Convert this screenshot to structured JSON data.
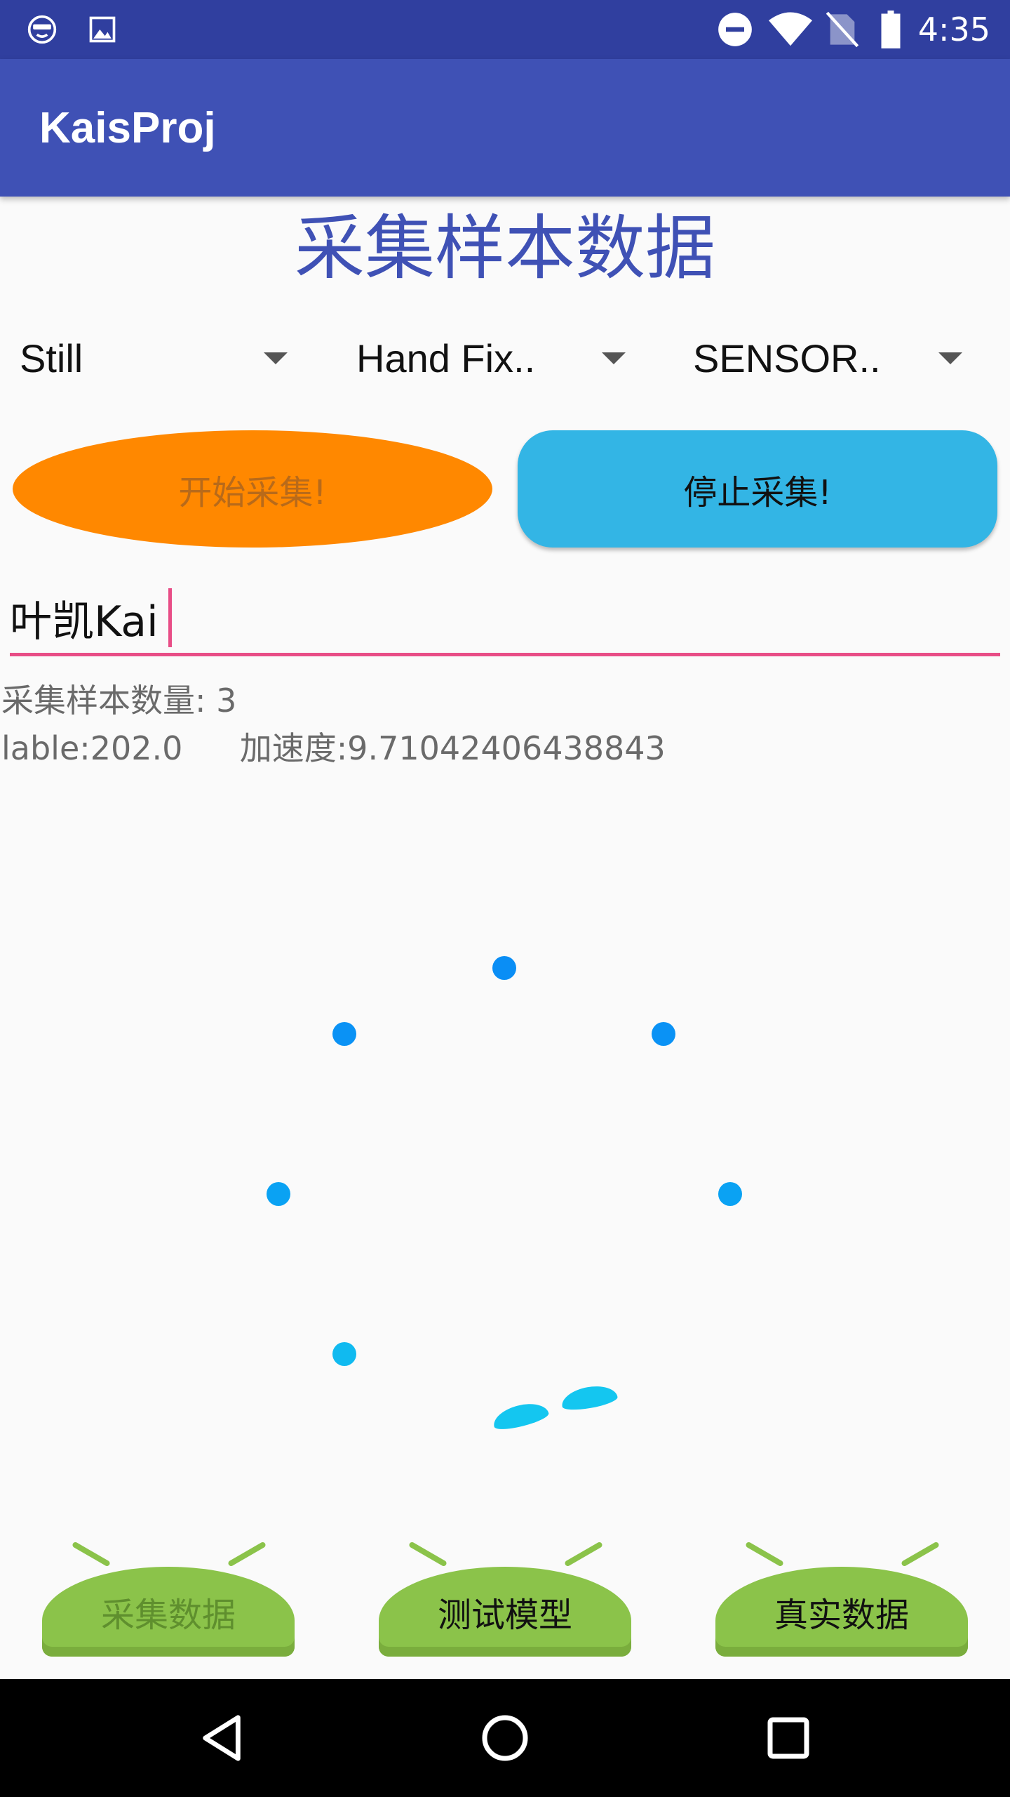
{
  "status_bar": {
    "time": "4:35"
  },
  "app_bar": {
    "title": "KaisProj"
  },
  "page": {
    "title": "采集样本数据"
  },
  "spinners": [
    {
      "selected": "Still"
    },
    {
      "selected": "Hand Fix.."
    },
    {
      "selected": "SENSOR.."
    }
  ],
  "buttons": {
    "start": "开始采集!",
    "stop": "停止采集!"
  },
  "name_input": {
    "value": "叶凯Kai"
  },
  "info": {
    "sample_count_label": "采集样本数量:",
    "sample_count": "3",
    "label_line": "lable:202.0",
    "accel_line": "加速度:9.71042406438843"
  },
  "bottom_buttons": {
    "collect": "采集数据",
    "test": "测试模型",
    "real": "真实数据"
  },
  "colors": {
    "status_bar": "#303f9f",
    "app_bar": "#3f51b5",
    "accent": "#e84d86",
    "start_button": "#ff8800",
    "stop_button": "#33b5e5",
    "bottom_button": "#8bc34a",
    "loader_dot": "#0a9cf5"
  },
  "icons": [
    "face-icon",
    "image-icon",
    "dnd-icon",
    "wifi-icon",
    "no-sim-icon",
    "battery-icon",
    "back-icon",
    "home-icon",
    "recents-icon"
  ]
}
